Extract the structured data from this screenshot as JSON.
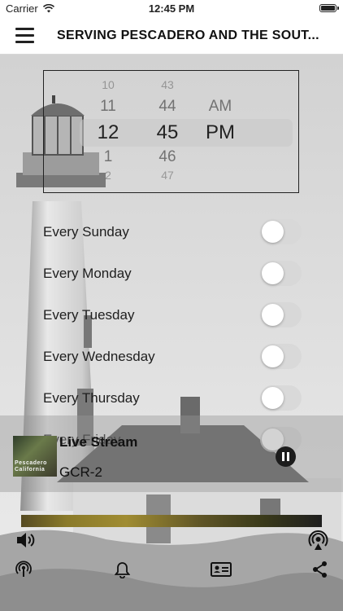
{
  "status_bar": {
    "carrier": "Carrier",
    "time": "12:45 PM"
  },
  "nav": {
    "title": "SERVING PESCADERO AND THE SOUT...",
    "menu_icon": "hamburger-icon"
  },
  "time_picker": {
    "hours": [
      "10",
      "11",
      "12",
      "1",
      "2"
    ],
    "minutes": [
      "43",
      "44",
      "45",
      "46",
      "47"
    ],
    "periods": [
      "AM",
      "PM"
    ],
    "selected": {
      "hour": "12",
      "minute": "45",
      "period": "PM"
    }
  },
  "schedule": [
    {
      "label": "Every Sunday",
      "enabled": false
    },
    {
      "label": "Every Monday",
      "enabled": false
    },
    {
      "label": "Every Tuesday",
      "enabled": false
    },
    {
      "label": "Every Wednesday",
      "enabled": false
    },
    {
      "label": "Every Thursday",
      "enabled": false
    },
    {
      "label": "Every Friday",
      "enabled": false
    }
  ],
  "player": {
    "title": "Live Stream",
    "subtitle": "GCR-2",
    "artwork_text": "Pescadero California",
    "state_icon": "pause-icon"
  },
  "bottom_icons": [
    "volume-icon",
    "airplay-icon",
    "podcast-icon",
    "bell-icon",
    "contact-card-icon",
    "share-icon"
  ]
}
